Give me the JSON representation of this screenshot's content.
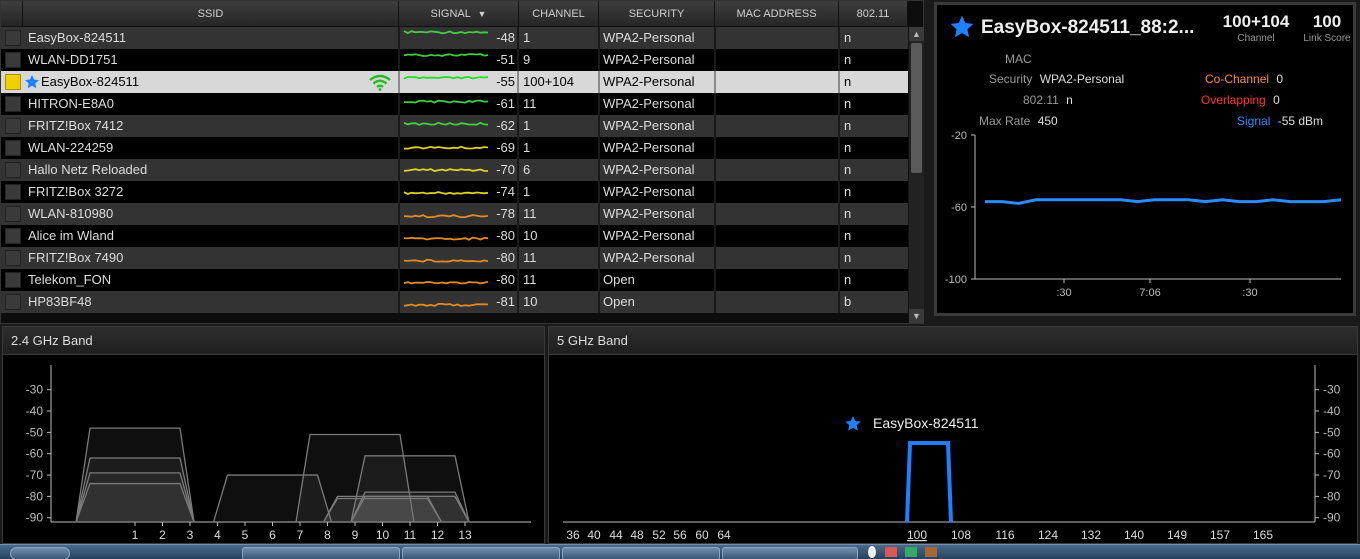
{
  "table": {
    "columns": [
      {
        "key": "ssid",
        "label": "SSID"
      },
      {
        "key": "signal",
        "label": "SIGNAL",
        "sort_icon": "sort-descending-icon"
      },
      {
        "key": "channel",
        "label": "CHANNEL"
      },
      {
        "key": "security",
        "label": "SECURITY"
      },
      {
        "key": "mac",
        "label": "MAC ADDRESS"
      },
      {
        "key": "protocol",
        "label": "802.11"
      }
    ],
    "rows": [
      {
        "ssid": "EasyBox-824511",
        "signal": "-48",
        "channel": "1",
        "security": "WPA2-Personal",
        "protocol": "n",
        "color": "#3ecf3e"
      },
      {
        "ssid": "WLAN-DD1751",
        "signal": "-51",
        "channel": "9",
        "security": "WPA2-Personal",
        "protocol": "n",
        "color": "#3ecf3e"
      },
      {
        "ssid": "EasyBox-824511",
        "signal": "-55",
        "channel": "100+104",
        "security": "WPA2-Personal",
        "protocol": "n",
        "color": "#22dd22",
        "selected": true,
        "starred": true,
        "connected": true
      },
      {
        "ssid": "HITRON-E8A0",
        "signal": "-61",
        "channel": "11",
        "security": "WPA2-Personal",
        "protocol": "n",
        "color": "#3ecf3e"
      },
      {
        "ssid": "FRITZ!Box 7412",
        "signal": "-62",
        "channel": "1",
        "security": "WPA2-Personal",
        "protocol": "n",
        "color": "#3ecf3e"
      },
      {
        "ssid": "WLAN-224259",
        "signal": "-69",
        "channel": "1",
        "security": "WPA2-Personal",
        "protocol": "n",
        "color": "#e0d020"
      },
      {
        "ssid": "Hallo Netz Reloaded",
        "signal": "-70",
        "channel": "6",
        "security": "WPA2-Personal",
        "protocol": "n",
        "color": "#e0d020"
      },
      {
        "ssid": "FRITZ!Box 3272",
        "signal": "-74",
        "channel": "1",
        "security": "WPA2-Personal",
        "protocol": "n",
        "color": "#e0d020"
      },
      {
        "ssid": "WLAN-810980",
        "signal": "-78",
        "channel": "11",
        "security": "WPA2-Personal",
        "protocol": "n",
        "color": "#e08a20"
      },
      {
        "ssid": "Alice im Wland",
        "signal": "-80",
        "channel": "10",
        "security": "WPA2-Personal",
        "protocol": "n",
        "color": "#e08a20"
      },
      {
        "ssid": "FRITZ!Box 7490",
        "signal": "-80",
        "channel": "11",
        "security": "WPA2-Personal",
        "protocol": "n",
        "color": "#e08a20"
      },
      {
        "ssid": "Telekom_FON",
        "signal": "-80",
        "channel": "11",
        "security": "Open",
        "protocol": "n",
        "color": "#e08a20"
      },
      {
        "ssid": "HP83BF48",
        "signal": "-81",
        "channel": "10",
        "security": "Open",
        "protocol": "b",
        "color": "#e08a20"
      }
    ]
  },
  "details": {
    "title": "EasyBox-824511_88:2...",
    "channel_value": "100+104",
    "channel_caption": "Channel",
    "link_score_value": "100",
    "link_score_caption": "Link Score",
    "mac_label": "MAC",
    "security_label": "Security",
    "security_value": "WPA2-Personal",
    "protocol_label": "802.11",
    "protocol_value": "n",
    "max_rate_label": "Max Rate",
    "max_rate_value": "450",
    "co_channel_label": "Co-Channel",
    "co_channel_value": "0",
    "overlapping_label": "Overlapping",
    "overlapping_value": "0",
    "signal_label": "Signal",
    "signal_value": "-55 dBm",
    "colors": {
      "co_channel": "#ff8a3c",
      "overlapping": "#ff3030",
      "signal": "#2a8cff"
    }
  },
  "band24": {
    "title": "2.4 GHz Band",
    "channels": [
      "1",
      "2",
      "3",
      "4",
      "5",
      "6",
      "7",
      "8",
      "9",
      "10",
      "11",
      "12",
      "13"
    ]
  },
  "band5": {
    "title": "5 GHz Band",
    "channels": [
      "36",
      "40",
      "44",
      "48",
      "52",
      "56",
      "60",
      "64",
      "100",
      "108",
      "116",
      "124",
      "132",
      "140",
      "149",
      "157",
      "165"
    ],
    "highlight_label": "EasyBox-824511",
    "highlight_channel": "100"
  },
  "chart_data": [
    {
      "type": "line",
      "name": "signal-history",
      "ylim": [
        -100,
        -20
      ],
      "yticks": [
        "-20",
        "-60",
        "-100"
      ],
      "xticks": [
        ":30",
        "7:06",
        ":30"
      ],
      "series": [
        {
          "values": [
            -57,
            -57,
            -58,
            -56,
            -56,
            -56,
            -56,
            -56,
            -56,
            -57,
            -56,
            -56,
            -56,
            -57,
            -56,
            -57,
            -57,
            -56,
            -57,
            -57,
            -57,
            -56
          ]
        }
      ],
      "color": "#2a8cff"
    },
    {
      "type": "area",
      "name": "2.4 GHz Band",
      "ylim": [
        -92,
        -25
      ],
      "yticks": [
        "-30",
        "-40",
        "-50",
        "-60",
        "-70",
        "-80",
        "-90"
      ],
      "networks": [
        {
          "channel": 1,
          "dbm": -48
        },
        {
          "channel": 1,
          "dbm": -62
        },
        {
          "channel": 1,
          "dbm": -69
        },
        {
          "channel": 1,
          "dbm": -74
        },
        {
          "channel": 6,
          "dbm": -70
        },
        {
          "channel": 9,
          "dbm": -51
        },
        {
          "channel": 10,
          "dbm": -80
        },
        {
          "channel": 10,
          "dbm": -81
        },
        {
          "channel": 11,
          "dbm": -61
        },
        {
          "channel": 11,
          "dbm": -78
        },
        {
          "channel": 11,
          "dbm": -80
        },
        {
          "channel": 11,
          "dbm": -80
        }
      ]
    },
    {
      "type": "area",
      "name": "5 GHz Band",
      "ylim": [
        -92,
        -25
      ],
      "yticks": [
        "-30",
        "-40",
        "-50",
        "-60",
        "-70",
        "-80",
        "-90"
      ],
      "networks": [
        {
          "channel": "100+104",
          "dbm": -55
        }
      ]
    }
  ]
}
